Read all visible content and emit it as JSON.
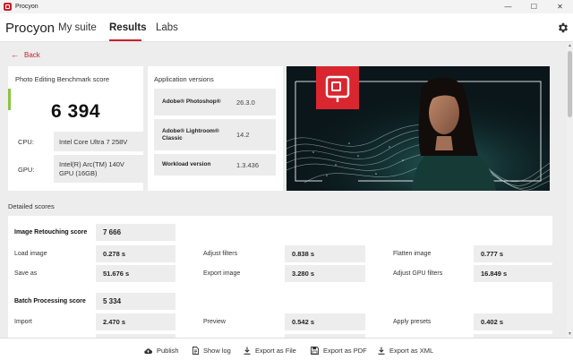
{
  "window": {
    "title": "Procyon",
    "minimize": "—",
    "maximize": "☐",
    "close": "✕"
  },
  "nav": {
    "brand": "Procyon",
    "tabs": [
      "My suite",
      "Results",
      "Labs"
    ],
    "active_tab": "Results"
  },
  "back_label": "Back",
  "score_card": {
    "label": "Photo Editing Benchmark score",
    "value": "6 394",
    "cpu_label": "CPU:",
    "cpu_value": "Intel Core Ultra 7 258V",
    "gpu_label": "GPU:",
    "gpu_value": "Intel(R) Arc(TM) 140V GPU (16GB)"
  },
  "versions_card": {
    "title": "Application versions",
    "items": [
      {
        "label": "Adobe® Photoshop®",
        "value": "26.3.0"
      },
      {
        "label": "Adobe® Lightroom® Classic",
        "value": "14.2"
      },
      {
        "label": "Workload version",
        "value": "1.3.436"
      }
    ]
  },
  "detailed": {
    "title": "Detailed scores",
    "image_retouching": {
      "label": "Image Retouching score",
      "score": "7 666",
      "rows": [
        [
          {
            "label": "Load image",
            "value": "0.278 s"
          },
          {
            "label": "Adjust filters",
            "value": "0.838 s"
          },
          {
            "label": "Flatten image",
            "value": "0.777 s"
          }
        ],
        [
          {
            "label": "Save as",
            "value": "51.676 s"
          },
          {
            "label": "Export image",
            "value": "3.280 s"
          },
          {
            "label": "Adjust GPU filters",
            "value": "16.849 s"
          }
        ]
      ]
    },
    "batch_processing": {
      "label": "Batch Processing score",
      "score": "5 334",
      "rows": [
        [
          {
            "label": "Import",
            "value": "2.470 s"
          },
          {
            "label": "Preview",
            "value": "0.542 s"
          },
          {
            "label": "Apply presets",
            "value": "0.402 s"
          }
        ]
      ]
    }
  },
  "footer": {
    "publish": "Publish",
    "show_log": "Show log",
    "export_file": "Export as File",
    "export_pdf": "Export as PDF",
    "export_xml": "Export as XML"
  },
  "colors": {
    "accent": "#c8202b",
    "score_bar": "#8bc43f"
  }
}
